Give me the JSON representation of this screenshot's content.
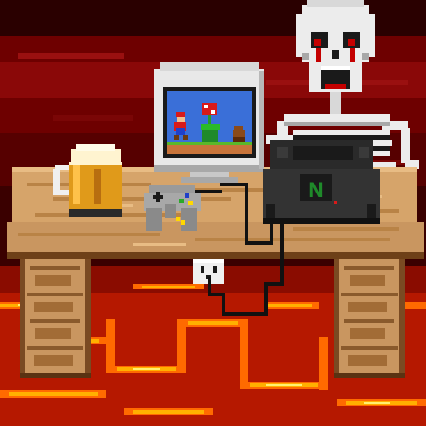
{
  "scene": {
    "console_logo": "N"
  },
  "palette": {
    "sky_dark": "#2a0000",
    "sky_mid": "#6e0000",
    "sky_light": "#b01010",
    "lava_dark": "#7a0a00",
    "lava_mid": "#d8300a",
    "lava_bright": "#ffb000",
    "lava_core": "#fff070",
    "wood_light": "#d6a46a",
    "wood_mid": "#b98346",
    "wood_dark": "#7a4a22",
    "bone": "#ececec",
    "bone_shadow": "#a8a8a8",
    "blood": "#c40000",
    "monitor_body": "#e8e8e8",
    "monitor_screen": "#3a6fd8",
    "console_body": "#2a2a2a",
    "console_logo_green": "#1f8a2a",
    "beer": "#e09a1a",
    "foam": "#fff4d0"
  },
  "icons": [
    "skull-icon",
    "skeleton-icon",
    "crt-monitor-icon",
    "game-console-icon",
    "gamepad-icon",
    "beer-mug-icon",
    "power-outlet-icon",
    "lava-icon"
  ]
}
